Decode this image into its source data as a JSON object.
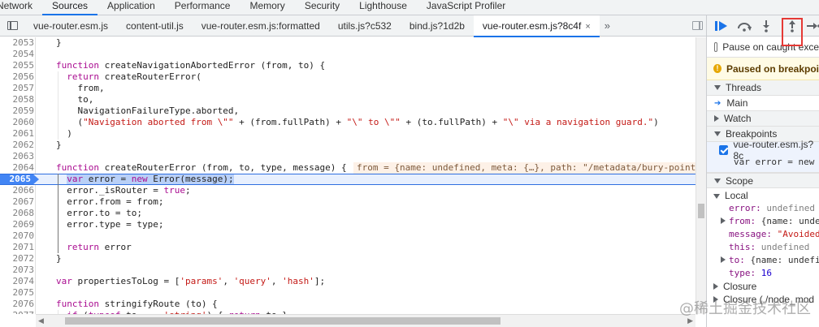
{
  "panel_tabs": [
    "Network",
    "Sources",
    "Application",
    "Performance",
    "Memory",
    "Security",
    "Lighthouse",
    "JavaScript Profiler"
  ],
  "active_panel_tab": "Sources",
  "file_tabs": [
    "vue-router.esm.js",
    "content-util.js",
    "vue-router.esm.js:formatted",
    "utils.js?c532",
    "bind.js?1d2b",
    "vue-router.esm.js?8c4f"
  ],
  "active_file_tab": "vue-router.esm.js?8c4f",
  "more_tabs": "»",
  "close_glyph": "×",
  "code": {
    "lines": [
      {
        "n": "2053",
        "t": "}"
      },
      {
        "n": "2054",
        "t": ""
      },
      {
        "n": "2055",
        "t": "function createNavigationAbortedError (from, to) {"
      },
      {
        "n": "2056",
        "t": "  return createRouterError("
      },
      {
        "n": "2057",
        "t": "    from,"
      },
      {
        "n": "2058",
        "t": "    to,"
      },
      {
        "n": "2059",
        "t": "    NavigationFailureType.aborted,"
      },
      {
        "n": "2060",
        "t": "    (\"Navigation aborted from \\\"\" + (from.fullPath) + \"\\\" to \\\"\" + (to.fullPath) + \"\\\" via a navigation guard.\")"
      },
      {
        "n": "2061",
        "t": "  )"
      },
      {
        "n": "2062",
        "t": "}"
      },
      {
        "n": "2063",
        "t": ""
      },
      {
        "n": "2064",
        "t": "function createRouterError (from, to, type, message) {"
      },
      {
        "n": "2065",
        "t": "  var error = new Error(message);"
      },
      {
        "n": "2066",
        "t": "  error._isRouter = true;"
      },
      {
        "n": "2067",
        "t": "  error.from = from;"
      },
      {
        "n": "2068",
        "t": "  error.to = to;"
      },
      {
        "n": "2069",
        "t": "  error.type = type;"
      },
      {
        "n": "2070",
        "t": ""
      },
      {
        "n": "2071",
        "t": "  return error"
      },
      {
        "n": "2072",
        "t": "}"
      },
      {
        "n": "2073",
        "t": ""
      },
      {
        "n": "2074",
        "t": "var propertiesToLog = ['params', 'query', 'hash'];"
      },
      {
        "n": "2075",
        "t": ""
      },
      {
        "n": "2076",
        "t": "function stringifyRoute (to) {"
      },
      {
        "n": "2077",
        "t": "  if (typeof to === 'string') { return to }"
      },
      {
        "n": "2078",
        "t": ""
      }
    ],
    "current_line": "2065",
    "inline_value": "from = {name: undefined, meta: {…}, path: \"/metadata/bury-point"
  },
  "debugger": {
    "pause_on_caught": "Pause on caught exce",
    "paused_banner": "Paused on breakpoi",
    "threads_label": "Threads",
    "main_thread": "Main",
    "watch_label": "Watch",
    "breakpoints_label": "Breakpoints",
    "breakpoint_file": "vue-router.esm.js?8c",
    "breakpoint_code": "var error = new",
    "scope_label": "Scope",
    "local_label": "Local",
    "scope": [
      {
        "key": "error",
        "val": "undefined",
        "kind": "undef",
        "expandable": false
      },
      {
        "key": "from",
        "val": "{name: unde",
        "kind": "obj",
        "expandable": true
      },
      {
        "key": "message",
        "val": "\"Avoided",
        "kind": "str",
        "expandable": false
      },
      {
        "key": "this",
        "val": "undefined",
        "kind": "undef",
        "expandable": false
      },
      {
        "key": "to",
        "val": "{name: undefi",
        "kind": "obj",
        "expandable": true
      },
      {
        "key": "type",
        "val": "16",
        "kind": "num",
        "expandable": false
      }
    ],
    "closure_label": "Closure",
    "closure2_label": "Closure (./node_mod"
  },
  "watermark": "@稀土掘金技术社区",
  "colors": {
    "accent": "#1a73e8",
    "exec_line": "#e8f0fe",
    "highlight": "#e53935"
  }
}
